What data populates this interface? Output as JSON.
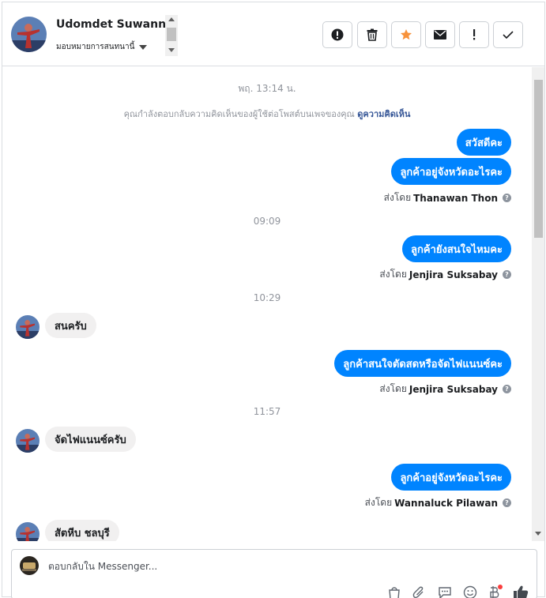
{
  "header": {
    "name": "Udomdet Suwannasri",
    "assign_label": "มอบหมายการสนทนานี้",
    "toolbar": [
      {
        "icon": "alert-icon",
        "name": "mark-important-button"
      },
      {
        "icon": "trash-icon",
        "name": "delete-button"
      },
      {
        "icon": "star-icon",
        "name": "star-button"
      },
      {
        "icon": "envelope-icon",
        "name": "mark-unread-button"
      },
      {
        "icon": "exclamation-icon",
        "name": "spam-button"
      },
      {
        "icon": "check-icon",
        "name": "done-button"
      }
    ],
    "colors": {
      "star": "#f7923b"
    }
  },
  "thread": {
    "timestamps": [
      "พฤ. 13:14 น.",
      "09:09",
      "10:29",
      "11:57"
    ],
    "notice_text": "คุณกำลังตอบกลับความคิดเห็นของผู้ใช้ต่อโพสต์บนเพจของคุณ",
    "notice_link": "ดูความคิดเห็น",
    "sent_by_prefix": "ส่งโดย",
    "messages_out": [
      "สวัสดีคะ",
      "ลูกค้าอยู่จังหวัดอะไรคะ",
      "ลูกค้ายังสนใจไหมคะ",
      "ลูกค้าสนใจตัดสดหรือจัดไฟแนนซ์คะ",
      "ลูกค้าอยู่จังหวัดอะไรคะ"
    ],
    "senders": [
      "Thanawan Thon",
      "Jenjira Suksabay",
      "Jenjira Suksabay",
      "Wannaluck Pilawan"
    ],
    "messages_in": [
      "สนครับ",
      "จัดไฟแนนซ์ครับ",
      "สัตหีบ ชลบุรี"
    ],
    "colors": {
      "outgoing_bubble": "#0084ff",
      "incoming_bubble": "#f1f0f0"
    }
  },
  "composer": {
    "placeholder": "ตอบกลับใน Messenger...",
    "icons": [
      "shopping-bag-icon",
      "paperclip-icon",
      "saved-reply-icon",
      "emoji-icon",
      "baht-payment-icon",
      "thumbs-up-icon"
    ]
  }
}
